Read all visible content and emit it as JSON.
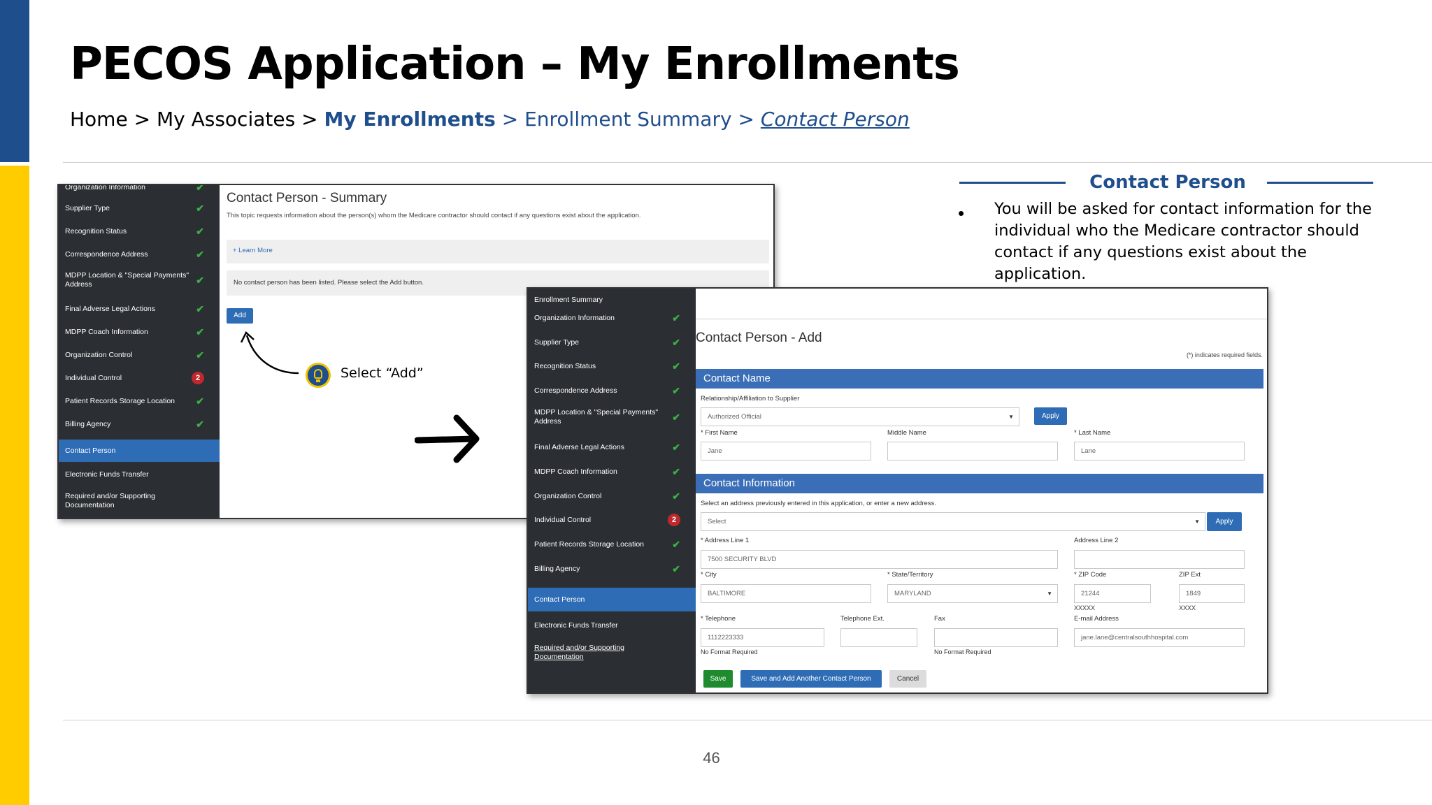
{
  "slide": {
    "title": "PECOS Application – My Enrollments",
    "page_number": "46"
  },
  "breadcrumb": {
    "home": "Home",
    "sep": ">",
    "associates": "My Associates",
    "enrollments": "My Enrollments",
    "summary": "Enrollment Summary",
    "current": "Contact Person"
  },
  "info_panel": {
    "heading": "Contact Person",
    "bullet": "•",
    "text": "You will be asked for contact information for the individual who the Medicare contractor should contact if any questions exist about the application."
  },
  "callout": {
    "text": "Select “Add”"
  },
  "colors": {
    "brand_blue": "#1f4e8c",
    "brand_yellow": "#ffcc00",
    "nav_bg": "#2b2f33",
    "nav_selected": "#2e6db6",
    "check_green": "#3cb043",
    "badge_red": "#c0282d"
  },
  "summary_screen": {
    "nav_items": [
      {
        "label": "Organization Information",
        "status": "check"
      },
      {
        "label": "Supplier Type",
        "status": "check"
      },
      {
        "label": "Recognition Status",
        "status": "check"
      },
      {
        "label": "Correspondence Address",
        "status": "check"
      },
      {
        "label": "MDPP Location & \"Special Payments\" Address",
        "status": "check"
      },
      {
        "label": "Final Adverse Legal Actions",
        "status": "check"
      },
      {
        "label": "MDPP Coach Information",
        "status": "check"
      },
      {
        "label": "Organization Control",
        "status": "check"
      },
      {
        "label": "Individual Control",
        "status": "badge",
        "badge": "2"
      },
      {
        "label": "Patient Records Storage Location",
        "status": "check"
      },
      {
        "label": "Billing Agency",
        "status": "check"
      },
      {
        "label": "Contact Person",
        "status": "selected"
      },
      {
        "label": "Electronic Funds Transfer",
        "status": "none"
      },
      {
        "label": "Required and/or Supporting Documentation",
        "status": "none"
      }
    ],
    "title": "Contact Person - Summary",
    "description": "This topic requests information about the person(s) whom the Medicare contractor should contact if any questions exist about the application.",
    "learn_more": "+ Learn More",
    "empty_message": "No contact person has been listed. Please select the Add button.",
    "add_label": "Add"
  },
  "add_screen": {
    "nav_items": [
      {
        "label": "Enrollment Summary",
        "status": "none"
      },
      {
        "label": "Organization Information",
        "status": "check"
      },
      {
        "label": "Supplier Type",
        "status": "check"
      },
      {
        "label": "Recognition Status",
        "status": "check"
      },
      {
        "label": "Correspondence Address",
        "status": "check"
      },
      {
        "label": "MDPP Location & \"Special Payments\" Address",
        "status": "check"
      },
      {
        "label": "Final Adverse Legal Actions",
        "status": "check"
      },
      {
        "label": "MDPP Coach Information",
        "status": "check"
      },
      {
        "label": "Organization Control",
        "status": "check"
      },
      {
        "label": "Individual Control",
        "status": "badge",
        "badge": "2"
      },
      {
        "label": "Patient Records Storage Location",
        "status": "check"
      },
      {
        "label": "Billing Agency",
        "status": "check"
      },
      {
        "label": "Contact Person",
        "status": "selected"
      },
      {
        "label": "Electronic Funds Transfer",
        "status": "none"
      },
      {
        "label": "Required and/or Supporting Documentation",
        "status": "link"
      }
    ],
    "title": "Contact Person - Add",
    "required_note": "(*) indicates required fields.",
    "contact_name": {
      "heading": "Contact Name",
      "relationship_label": "Relationship/Affiliation to Supplier",
      "relationship_value": "Authorized Official",
      "apply": "Apply",
      "first_label": "* First Name",
      "first_value": "Jane",
      "middle_label": "Middle Name",
      "middle_value": "",
      "last_label": "* Last Name",
      "last_value": "Lane"
    },
    "contact_info": {
      "heading": "Contact Information",
      "address_prompt": "Select an address previously entered in this application, or enter a new address.",
      "address_select": "Select",
      "apply": "Apply",
      "addr1_label": "* Address Line 1",
      "addr1_value": "7500 SECURITY BLVD",
      "addr2_label": "Address Line 2",
      "addr2_value": "",
      "city_label": "* City",
      "city_value": "BALTIMORE",
      "state_label": "* State/Territory",
      "state_value": "MARYLAND",
      "zip_label": "* ZIP Code",
      "zip_value": "21244",
      "zip_hint": "XXXXX",
      "zipext_label": "ZIP Ext",
      "zipext_value": "1849",
      "zipext_hint": "XXXX",
      "phone_label": "* Telephone",
      "phone_value": "1112223333",
      "phone_hint": "No Format Required",
      "ext_label": "Telephone Ext.",
      "ext_value": "",
      "fax_label": "Fax",
      "fax_value": "",
      "fax_hint": "No Format Required",
      "email_label": "E-mail Address",
      "email_value": "jane.lane@centralsouthhospital.com"
    },
    "buttons": {
      "save": "Save",
      "save_add": "Save and Add Another Contact Person",
      "cancel": "Cancel"
    }
  }
}
